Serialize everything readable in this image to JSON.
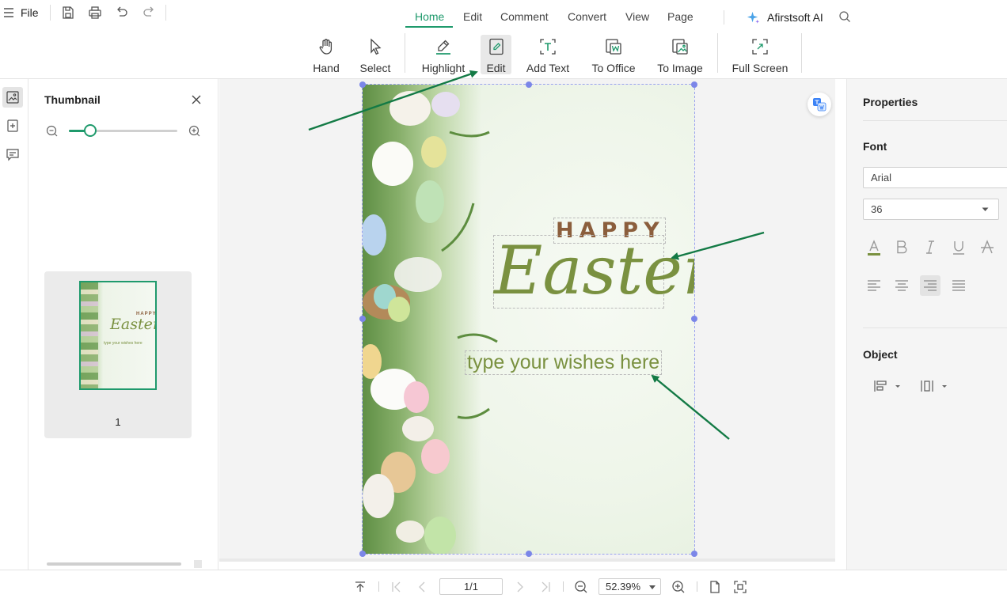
{
  "menu": {
    "file_label": "File"
  },
  "tabs": [
    "Home",
    "Edit",
    "Comment",
    "Convert",
    "View",
    "Page"
  ],
  "ai_label": "Afirstsoft AI",
  "toolbar": {
    "hand": "Hand",
    "select": "Select",
    "highlight": "Highlight",
    "edit": "Edit",
    "add_text": "Add Text",
    "to_office": "To Office",
    "to_image": "To Image",
    "full_screen": "Full Screen"
  },
  "thumbnail": {
    "title": "Thumbnail",
    "page_number": "1",
    "zoom_level": 0.2,
    "mini_happy": "HAPPY",
    "mini_easter": "Easter",
    "mini_wishes": "type your wishes here"
  },
  "document": {
    "happy": "HAPPY",
    "easter": "Easter",
    "wishes": "type your wishes here"
  },
  "properties": {
    "title": "Properties",
    "font_section": "Font",
    "font_family_value": "Arial",
    "font_size_value": "36",
    "object_section": "Object"
  },
  "bottom": {
    "page_indicator": "1/1",
    "zoom": "52.39%"
  },
  "colors": {
    "accent": "#1f9a6c",
    "easter_green": "#7a9140",
    "happy_brown": "#8b5e3c",
    "arrow": "#137a45",
    "selection": "#7b86e8"
  }
}
